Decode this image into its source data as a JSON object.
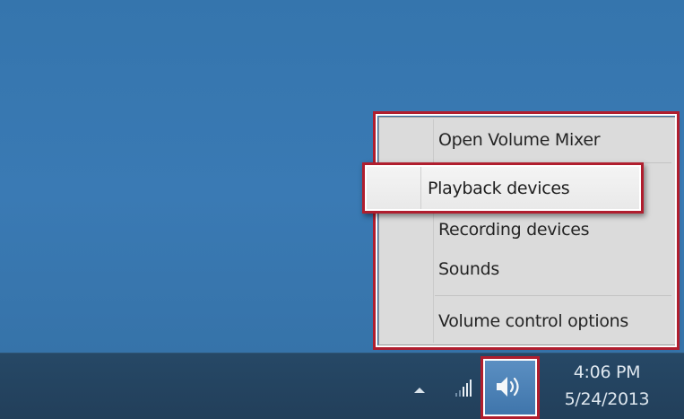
{
  "context_menu": {
    "items": [
      {
        "label": "Open Volume Mixer"
      },
      {
        "label": "Playback devices",
        "highlighted": true
      },
      {
        "label": "Recording devices"
      },
      {
        "label": "Sounds"
      },
      {
        "label": "Volume control options"
      }
    ]
  },
  "taskbar": {
    "tray_expand_icon": "chevron-up-icon",
    "network_icon": "signal-bars-icon",
    "volume_icon": "speaker-icon",
    "clock": {
      "time": "4:06 PM",
      "date": "5/24/2013"
    }
  },
  "colors": {
    "desktop": "#3a7ab4",
    "taskbar": "#223f5a",
    "highlight_frame": "#b01e2e",
    "menu_bg": "#f0f0f0"
  }
}
